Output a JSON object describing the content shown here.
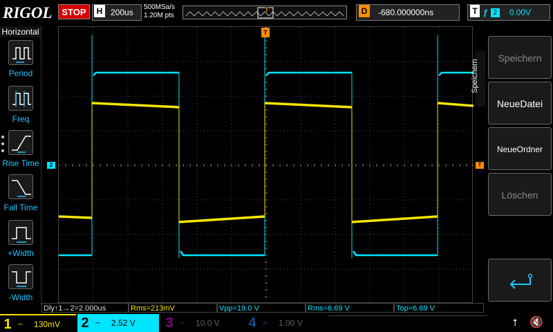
{
  "header": {
    "brand": "RIGOL",
    "run_state": "STOP",
    "timebase_label": "H",
    "timebase_value": "200us",
    "sample_rate": "500MSa/s",
    "memory_depth": "1.20M pts",
    "trigger_marker": "T",
    "delay_label": "D",
    "delay_value": "-680.000000ns",
    "trigger_label": "T",
    "trigger_edge": "ƒ",
    "trigger_source": "2",
    "trigger_level": "0.00V"
  },
  "left_panel": {
    "title": "Horizontal",
    "items": [
      {
        "label": "Period",
        "icon": "period-icon"
      },
      {
        "label": "Freq",
        "icon": "frequency-icon"
      },
      {
        "label": "Rise Time",
        "icon": "rise-time-icon"
      },
      {
        "label": "Fall Time",
        "icon": "fall-time-icon"
      },
      {
        "label": "+Width",
        "icon": "positive-width-icon"
      },
      {
        "label": "-Width",
        "icon": "negative-width-icon"
      }
    ]
  },
  "right_panel": {
    "title": "Speichern",
    "buttons": [
      {
        "label": "Speichern",
        "state": "disabled"
      },
      {
        "label": "NeueDatei",
        "state": "enabled"
      },
      {
        "label": "NeueOrdner",
        "state": "enabled"
      },
      {
        "label": "Löschen",
        "state": "disabled"
      }
    ],
    "return_icon": "return-arrow-icon"
  },
  "screen": {
    "ch2_marker": "2",
    "trigger_level_marker": "T",
    "trigger_position_marker": "T",
    "colors": {
      "ch1": "#f5e600",
      "ch2": "#00e5ff",
      "trigger": "#ff8c00",
      "grid": "#555555"
    }
  },
  "measurements": [
    {
      "text": "Dly↑1→2=2.000us",
      "color": "white"
    },
    {
      "text": "Rms=213mV",
      "color": "yellow"
    },
    {
      "text": "Vpp=19.0 V",
      "color": "cyan"
    },
    {
      "text": "Rms=6.69 V",
      "color": "cyan"
    },
    {
      "text": "Top=6.69 V",
      "color": "cyan"
    }
  ],
  "channels": [
    {
      "num": "1",
      "coupling": "~",
      "scale": "130mV"
    },
    {
      "num": "2",
      "coupling": "~",
      "scale": "2.52 V"
    },
    {
      "num": "3",
      "coupling": "~",
      "scale": "10.0 V"
    },
    {
      "num": "4",
      "coupling": "=",
      "scale": "1.00 V"
    }
  ],
  "status_icons": [
    "usb-icon",
    "speaker-muted-icon"
  ]
}
